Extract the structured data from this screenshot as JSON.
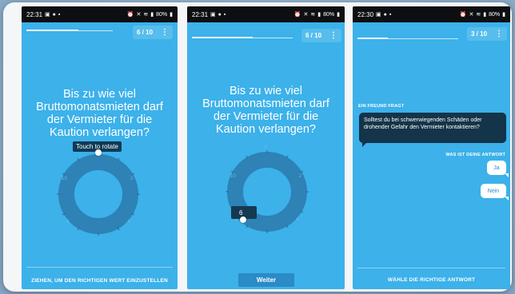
{
  "screens": [
    {
      "status": {
        "time": "22:31",
        "battery": "80%"
      },
      "counter": "6 / 10",
      "question": "Bis zu wie viel Bruttomonatsmieten darf der Vermieter für die Kaution verlangen?",
      "tooltip": "Touch to rotate",
      "bottom_hint": "ZIEHEN, UM DEN RICHTIGEN WERT EINZUSTELLEN",
      "progress": 0.6
    },
    {
      "status": {
        "time": "22:31",
        "battery": "80%"
      },
      "counter": "6 / 10",
      "question": "Bis zu wie viel Bruttomonatsmieten darf der Vermieter für die Kaution verlangen?",
      "selected_value": "6",
      "next_button": "Weiter",
      "progress": 0.6
    },
    {
      "status": {
        "time": "22:30",
        "battery": "80%"
      },
      "counter": "3 / 10",
      "friend_label": "EIN FREUND FRAGT",
      "friend_message": "Solltest du bei schwerwiegenden Schäden oder drohender Gefahr den Vermieter kontaktieren?",
      "answer_label": "WAS IST DEINE ANTWORT",
      "answers": [
        "Ja",
        "Nein"
      ],
      "bottom_hint": "WÄHLE DIE RICHTIGE ANTWORT",
      "progress": 0.3
    }
  ],
  "colors": {
    "screen_bg": "#3cb1ea",
    "dial_ring": "#2e82b5",
    "dark_bubble": "#133449",
    "button": "#2a8bc6"
  },
  "icons": [
    "more-vert-icon",
    "signal-icon",
    "wifi-icon",
    "battery-icon",
    "mute-icon"
  ]
}
